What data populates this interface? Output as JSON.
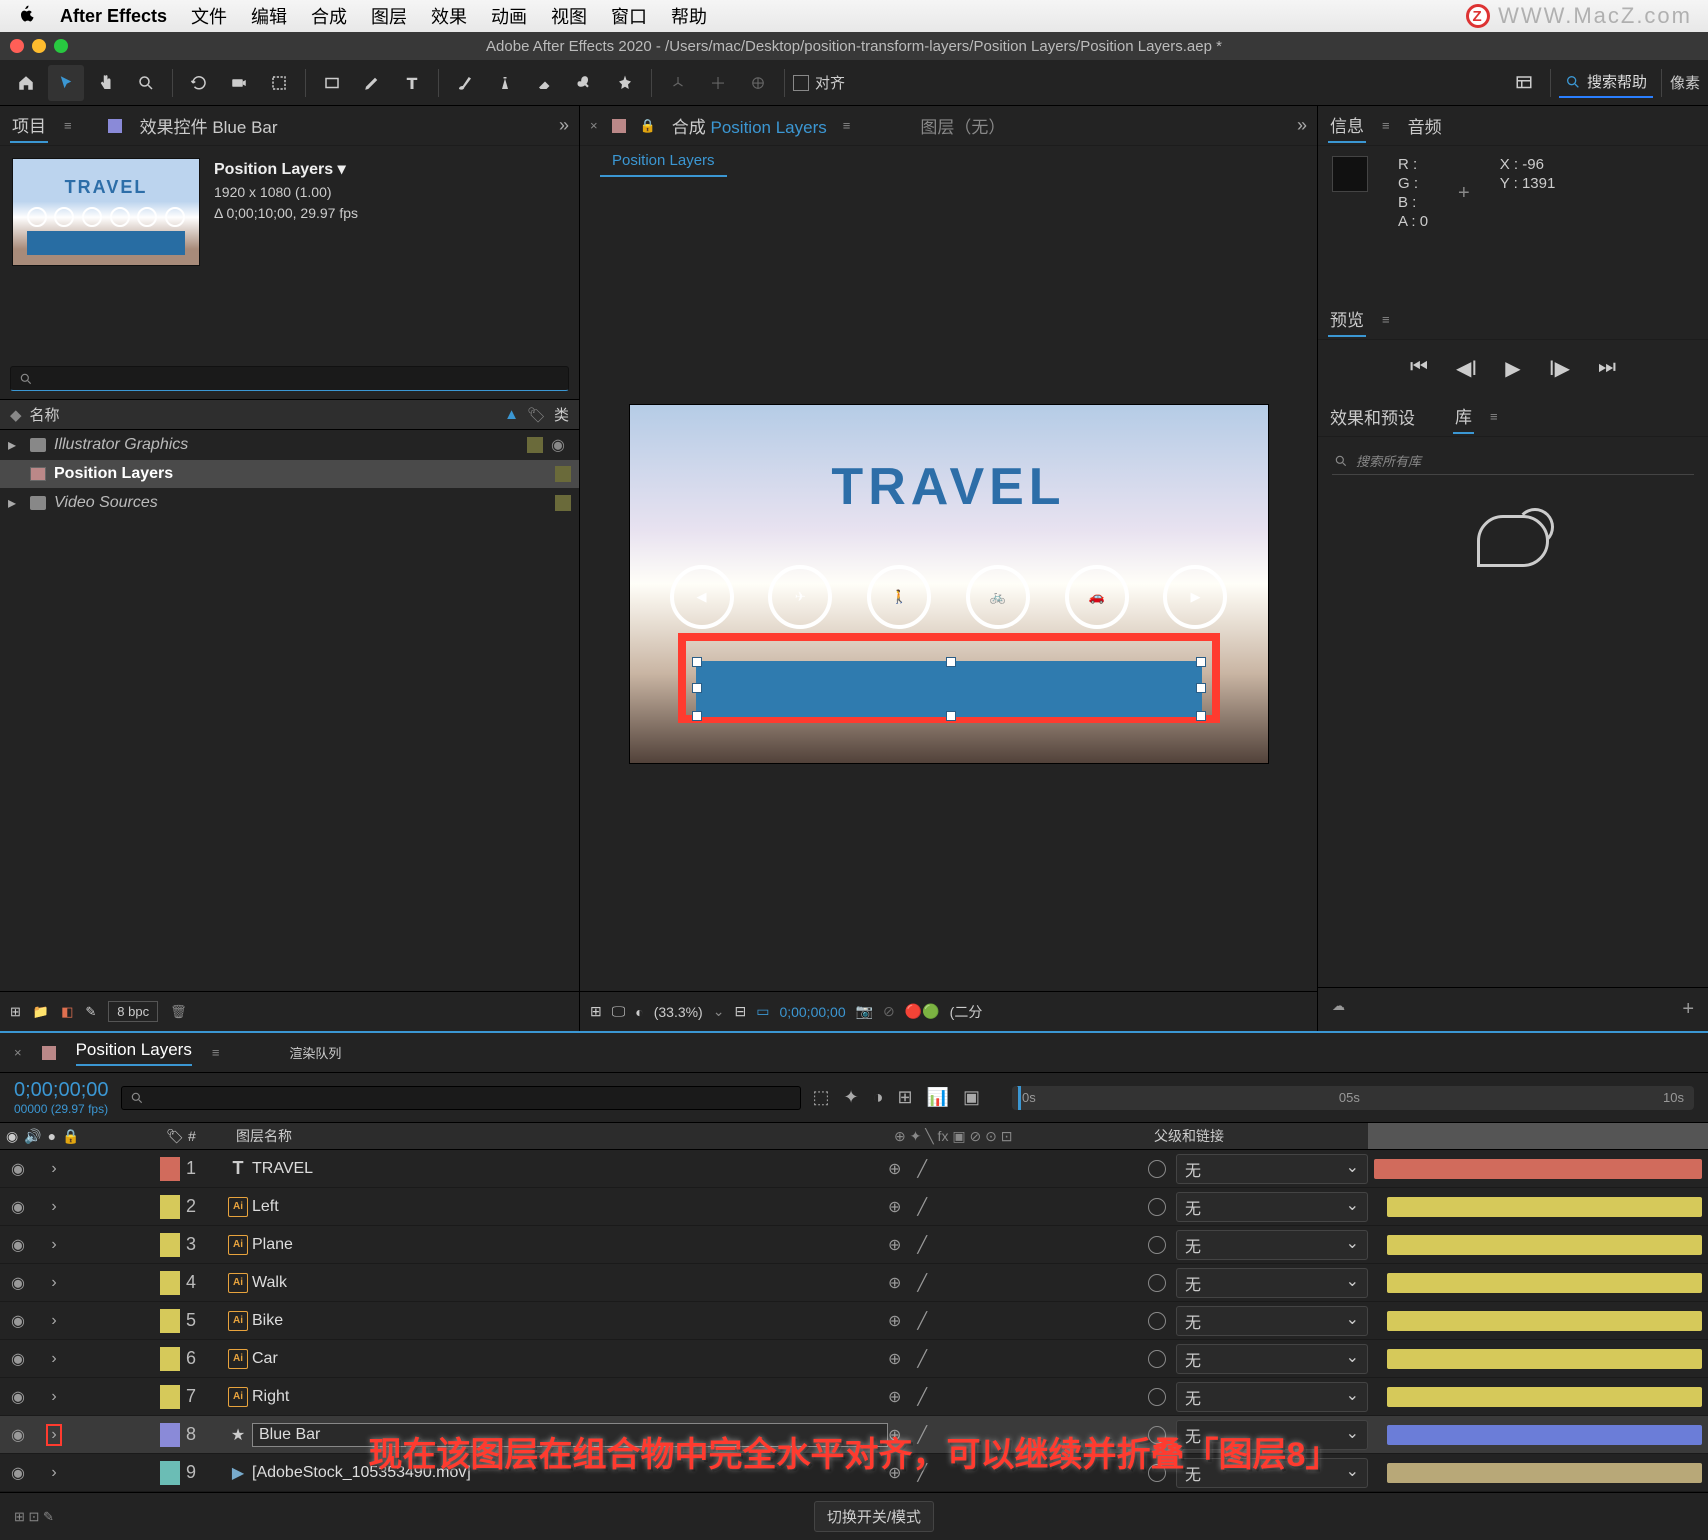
{
  "menubar": {
    "app": "After Effects",
    "items": [
      "文件",
      "编辑",
      "合成",
      "图层",
      "效果",
      "动画",
      "视图",
      "窗口",
      "帮助"
    ],
    "watermark": "WWW.MacZ.com"
  },
  "titlebar": {
    "text": "Adobe After Effects 2020 - /Users/mac/Desktop/position-transform-layers/Position Layers/Position Layers.aep *"
  },
  "toolbar": {
    "align": "对齐",
    "search_help": "搜索帮助",
    "pixels": "像素"
  },
  "project": {
    "tab": "项目",
    "fx_tab": "效果控件 Blue Bar",
    "comp_name": "Position Layers",
    "comp_size": "1920 x 1080 (1.00)",
    "comp_dur": "Δ 0;00;10;00, 29.97 fps",
    "name_header": "名称",
    "type_header": "类",
    "search_placeholder": "",
    "tree": [
      {
        "name": "Illustrator Graphics",
        "type": "folder"
      },
      {
        "name": "Position Layers",
        "type": "comp",
        "selected": true
      },
      {
        "name": "Video Sources",
        "type": "folder"
      }
    ],
    "bpc": "8 bpc"
  },
  "comp": {
    "tab_comp": "合成 Position Layers",
    "tab_layer": "图层（无）",
    "crumb": "Position Layers",
    "travel": "TRAVEL",
    "footer": {
      "zoom": "(33.3%)",
      "time": "0;00;00;00",
      "res": "(二分"
    }
  },
  "info": {
    "tab_info": "信息",
    "tab_audio": "音频",
    "R": "R :",
    "G": "G :",
    "B": "B :",
    "A": "A :",
    "Aval": "0",
    "X": "X :",
    "Xval": "-96",
    "Y": "Y :",
    "Yval": "1391"
  },
  "preview": {
    "tab": "预览"
  },
  "effects": {
    "tab_ep": "效果和预设",
    "tab_lib": "库",
    "search_placeholder": "搜索所有库"
  },
  "timeline": {
    "tab": "Position Layers",
    "tab_render": "渲染队列",
    "time": "0;00;00;00",
    "frame": "00000 (29.97 fps)",
    "ruler": [
      "0s",
      "05s",
      "10s"
    ],
    "col_name": "图层名称",
    "col_parent": "父级和链接",
    "parent_none": "无",
    "layers": [
      {
        "n": 1,
        "name": "TRAVEL",
        "icon": "T",
        "label": "lc-red",
        "bar": "lb-red"
      },
      {
        "n": 2,
        "name": "Left",
        "icon": "Ai",
        "label": "lc-yel",
        "bar": "lb-yel"
      },
      {
        "n": 3,
        "name": "Plane",
        "icon": "Ai",
        "label": "lc-yel",
        "bar": "lb-yel"
      },
      {
        "n": 4,
        "name": "Walk",
        "icon": "Ai",
        "label": "lc-yel",
        "bar": "lb-yel"
      },
      {
        "n": 5,
        "name": "Bike",
        "icon": "Ai",
        "label": "lc-yel",
        "bar": "lb-yel"
      },
      {
        "n": 6,
        "name": "Car",
        "icon": "Ai",
        "label": "lc-yel",
        "bar": "lb-yel"
      },
      {
        "n": 7,
        "name": "Right",
        "icon": "Ai",
        "label": "lc-yel",
        "bar": "lb-yel"
      },
      {
        "n": 8,
        "name": "Blue Bar",
        "icon": "★",
        "label": "lc-blue",
        "bar": "lb-blue",
        "selected": true,
        "boxed": true,
        "highlight": true
      },
      {
        "n": 9,
        "name": "[AdobeStock_105353490.mov]",
        "icon": "▶",
        "label": "lc-teal",
        "bar": "lb-sand",
        "bracket": true
      }
    ],
    "mode_btn": "切换开关/模式"
  },
  "caption": "现在该图层在组合物中完全水平对齐，可以继续并折叠「图层8」"
}
